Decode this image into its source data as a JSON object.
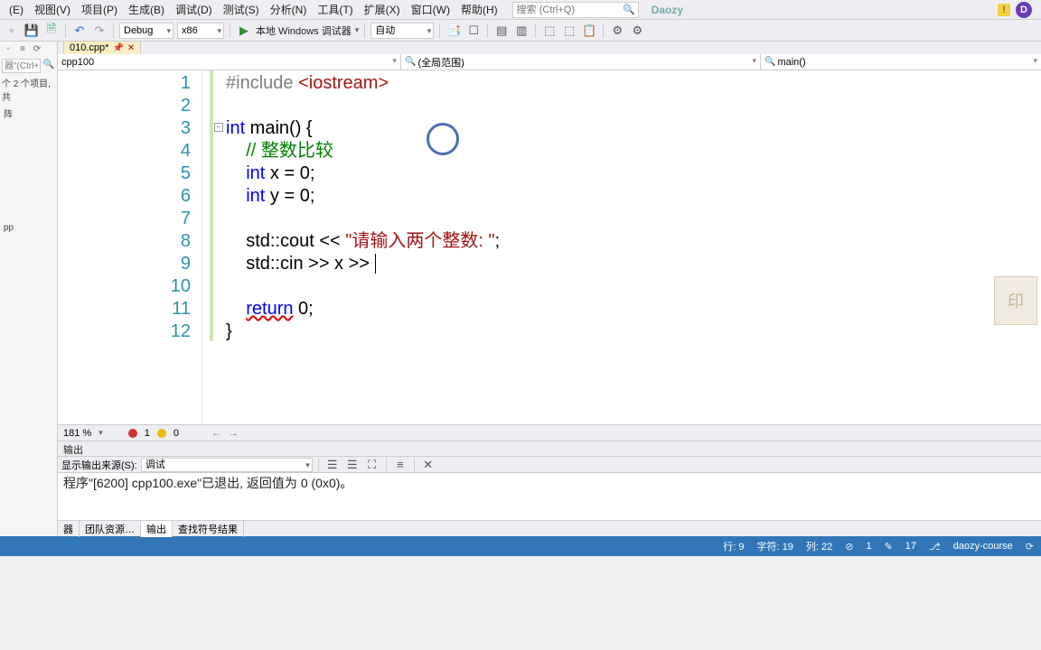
{
  "menu": {
    "items": [
      "(E)",
      "视图(V)",
      "项目(P)",
      "生成(B)",
      "调试(D)",
      "测试(S)",
      "分析(N)",
      "工具(T)",
      "扩展(X)",
      "窗口(W)",
      "帮助(H)"
    ],
    "search_placeholder": "搜索 (Ctrl+Q)",
    "brand": "Daozy",
    "user_initial": "D"
  },
  "toolbar": {
    "config": "Debug",
    "platform": "x86",
    "debugger": "本地 Windows 调试器",
    "auto": "自动"
  },
  "sidebar": {
    "search_placeholder": "器\"(Ctrl+;)",
    "summary": "个 2 个项目, 共",
    "item1": "阵",
    "item2": "pp"
  },
  "tabs": {
    "active": "010.cpp*"
  },
  "nav": {
    "left": "cpp100",
    "center": "(全局范围)",
    "right": "main()"
  },
  "code": {
    "lines": [
      {
        "n": "1",
        "html": "<span class='pp'>#include</span> <span class='inc'>&lt;iostream&gt;</span>"
      },
      {
        "n": "2",
        "html": ""
      },
      {
        "n": "3",
        "html": "<span class='kw'>int</span> main() {"
      },
      {
        "n": "4",
        "html": "    <span class='cmt'>// 整数比较</span>"
      },
      {
        "n": "5",
        "html": "    <span class='kw'>int</span> x = 0;"
      },
      {
        "n": "6",
        "html": "    <span class='kw'>int</span> y = 0;"
      },
      {
        "n": "7",
        "html": ""
      },
      {
        "n": "8",
        "html": "    std::cout &lt;&lt; <span class='str'>\"请输入两个整数: \"</span>;"
      },
      {
        "n": "9",
        "html": "    std::cin &gt;&gt; x &gt;&gt; <span class='cursor'></span>"
      },
      {
        "n": "10",
        "html": ""
      },
      {
        "n": "11",
        "html": "    <span class='kw err'>return</span> 0;"
      },
      {
        "n": "12",
        "html": "}"
      }
    ]
  },
  "zoom": {
    "pct": "181 %",
    "errors": "1",
    "warnings": "0"
  },
  "output": {
    "title": "输出",
    "src_label": "显示输出来源(S):",
    "src_value": "调试",
    "line1": "程序\"[6200] cpp100.exe\"已退出, 返回值为 0 (0x0)。"
  },
  "bottom_tabs": {
    "t0": "器",
    "t1": "团队资源…",
    "t2": "输出",
    "t3": "查找符号结果"
  },
  "status": {
    "line_label": "行: 9",
    "char_label": "字符: 19",
    "col_label": "列: 22",
    "err_count": "1",
    "warn_count": "17",
    "repo": "daozy-course"
  }
}
